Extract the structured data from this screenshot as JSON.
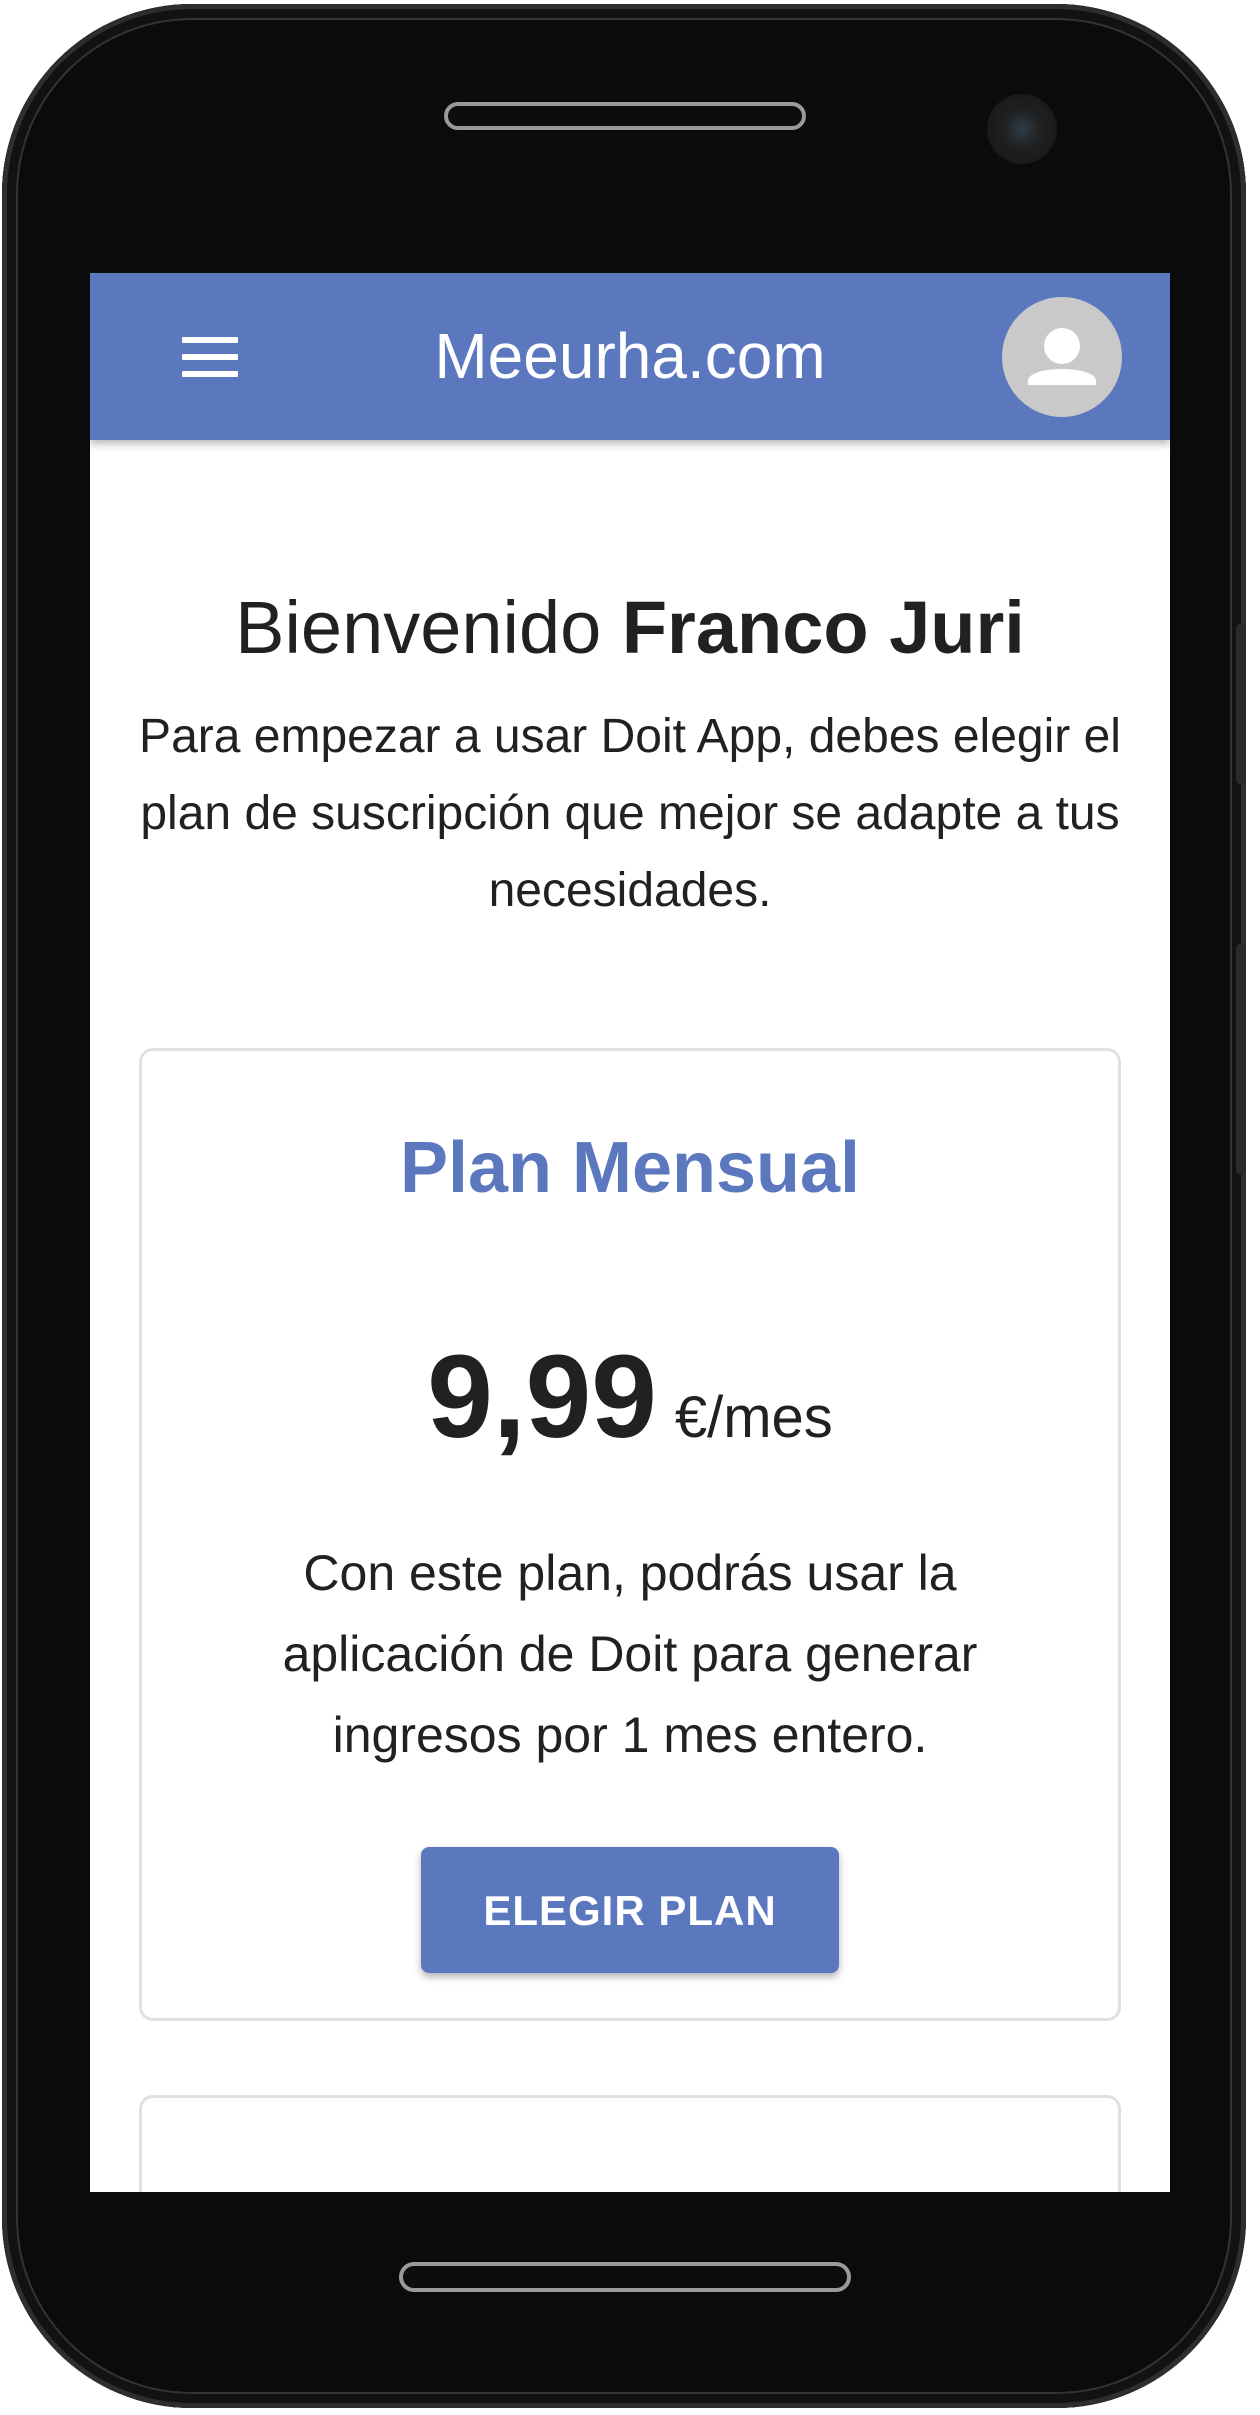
{
  "header": {
    "title": "Meeurha.com",
    "menu_icon": "hamburger-menu-icon",
    "avatar_icon": "user-avatar-icon"
  },
  "welcome": {
    "greeting": "Bienvenido",
    "user_name": "Franco Juri",
    "intro": "Para empezar a usar Doit App, debes elegir el plan de suscripción que mejor se adapte a tus necesidades."
  },
  "plans": [
    {
      "name": "Plan Mensual",
      "price": "9,99",
      "unit": "€/mes",
      "description": "Con este plan, podrás usar la aplicación de Doit para generar ingresos por 1 mes entero.",
      "button_label": "ELEGIR PLAN"
    }
  ],
  "colors": {
    "primary": "#5b78bf",
    "text": "#212121",
    "avatar_bg": "#c9c9c9",
    "card_border": "#e0e0e0"
  }
}
